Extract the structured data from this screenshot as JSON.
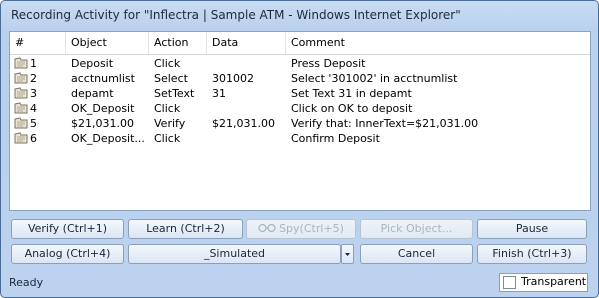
{
  "window": {
    "title": "Recording Activity for \"Inflectra | Sample ATM - Windows Internet Explorer\""
  },
  "table": {
    "columns": [
      "#",
      "Object",
      "Action",
      "Data",
      "Comment"
    ],
    "rows": [
      {
        "num": "1",
        "object": "Deposit",
        "action": "Click",
        "data": "",
        "comment": "Press Deposit"
      },
      {
        "num": "2",
        "object": "acctnumlist",
        "action": "Select",
        "data": "301002",
        "comment": "Select '301002' in acctnumlist"
      },
      {
        "num": "3",
        "object": "depamt",
        "action": "SetText",
        "data": "31",
        "comment": "Set Text 31 in depamt"
      },
      {
        "num": "4",
        "object": "OK_Deposit",
        "action": "Click",
        "data": "",
        "comment": "Click on OK to deposit"
      },
      {
        "num": "5",
        "object": "$21,031.00",
        "action": "Verify",
        "data": "$21,031.00",
        "comment": "Verify that: InnerText=$21,031.00"
      },
      {
        "num": "6",
        "object": "OK_Deposit...",
        "action": "Click",
        "data": "",
        "comment": "Confirm Deposit"
      }
    ]
  },
  "buttons": {
    "verify": "Verify (Ctrl+1)",
    "learn": "Learn (Ctrl+2)",
    "spy": "Spy(Ctrl+5)",
    "pick_object": "Pick Object...",
    "pause": "Pause",
    "analog": "Analog (Ctrl+4)",
    "simulated": "_Simulated",
    "cancel": "Cancel",
    "finish": "Finish (Ctrl+3)"
  },
  "status": {
    "text": "Ready",
    "transparent_label": "Transparent",
    "transparent_checked": false
  },
  "icons": {
    "row_icon": "step-icon",
    "spy_icon": "glasses-icon",
    "dropdown": "chevron-down-icon"
  }
}
